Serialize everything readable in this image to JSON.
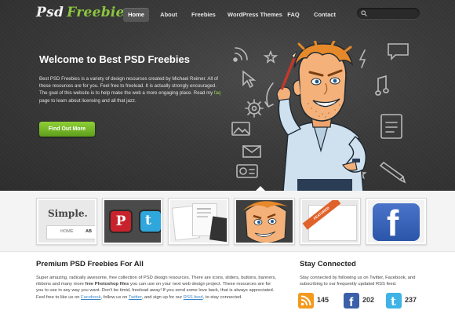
{
  "header": {
    "logo_part1": "Psd",
    "logo_part2": "Freebies",
    "nav": [
      {
        "label": "Home"
      },
      {
        "label": "About"
      },
      {
        "label": "Freebies"
      },
      {
        "label": "WordPress Themes"
      },
      {
        "label": "FAQ"
      },
      {
        "label": "Contact"
      }
    ],
    "search_placeholder": ""
  },
  "hero": {
    "title": "Welcome to Best PSD Freebies",
    "text_before_link": "Best PSD Freebies is a variety of design resources created by Michael Reimer. All of these resources are for you. Feel free to freeload. It is actually strongly encouraged. The goal of this website is to help make the web a more engaging place. Read my ",
    "link_faq": "faq",
    "text_after_link": " page to learn about licensing and all that jazz.",
    "cta": "Find Out More"
  },
  "thumbnails": [
    {
      "name": "simple",
      "title": "Simple.",
      "tab1": "HOME",
      "tab2": "AB"
    },
    {
      "name": "social-icons"
    },
    {
      "name": "papers"
    },
    {
      "name": "mascot"
    },
    {
      "name": "featured-ribbon",
      "ribbon": "FEATURED"
    },
    {
      "name": "facebook"
    }
  ],
  "premium": {
    "title": "Premium PSD Freebies For All",
    "t1": "Super amazing, radically awesome, free collection of PSD design resources. There are icons, sliders, buttons, banners, ribbons and many more ",
    "bold1": "free Photoshop files",
    "t2": " you can use on your next web design project. These resources are for you to use in any way you want. Don't be timid, freeload away! If you send some love back, that is always appreciated. Feel free to like us on ",
    "link_facebook": "Facebook",
    "t3": ", follow us on ",
    "link_twitter": "Twitter",
    "t4": ", and sign up for our ",
    "link_rss": "RSS feed",
    "t5": ", to stay connected."
  },
  "stay": {
    "title": "Stay Connected",
    "text": "Stay connected by following us on Twitter, Facebook, and subscribing to our frequently updated RSS feed.",
    "rss_count": "145",
    "facebook_count": "202",
    "twitter_count": "237"
  },
  "colors": {
    "accent_green": "#8cc63f",
    "hero_bg": "#3a3a3a",
    "link_blue": "#3a86c8"
  }
}
